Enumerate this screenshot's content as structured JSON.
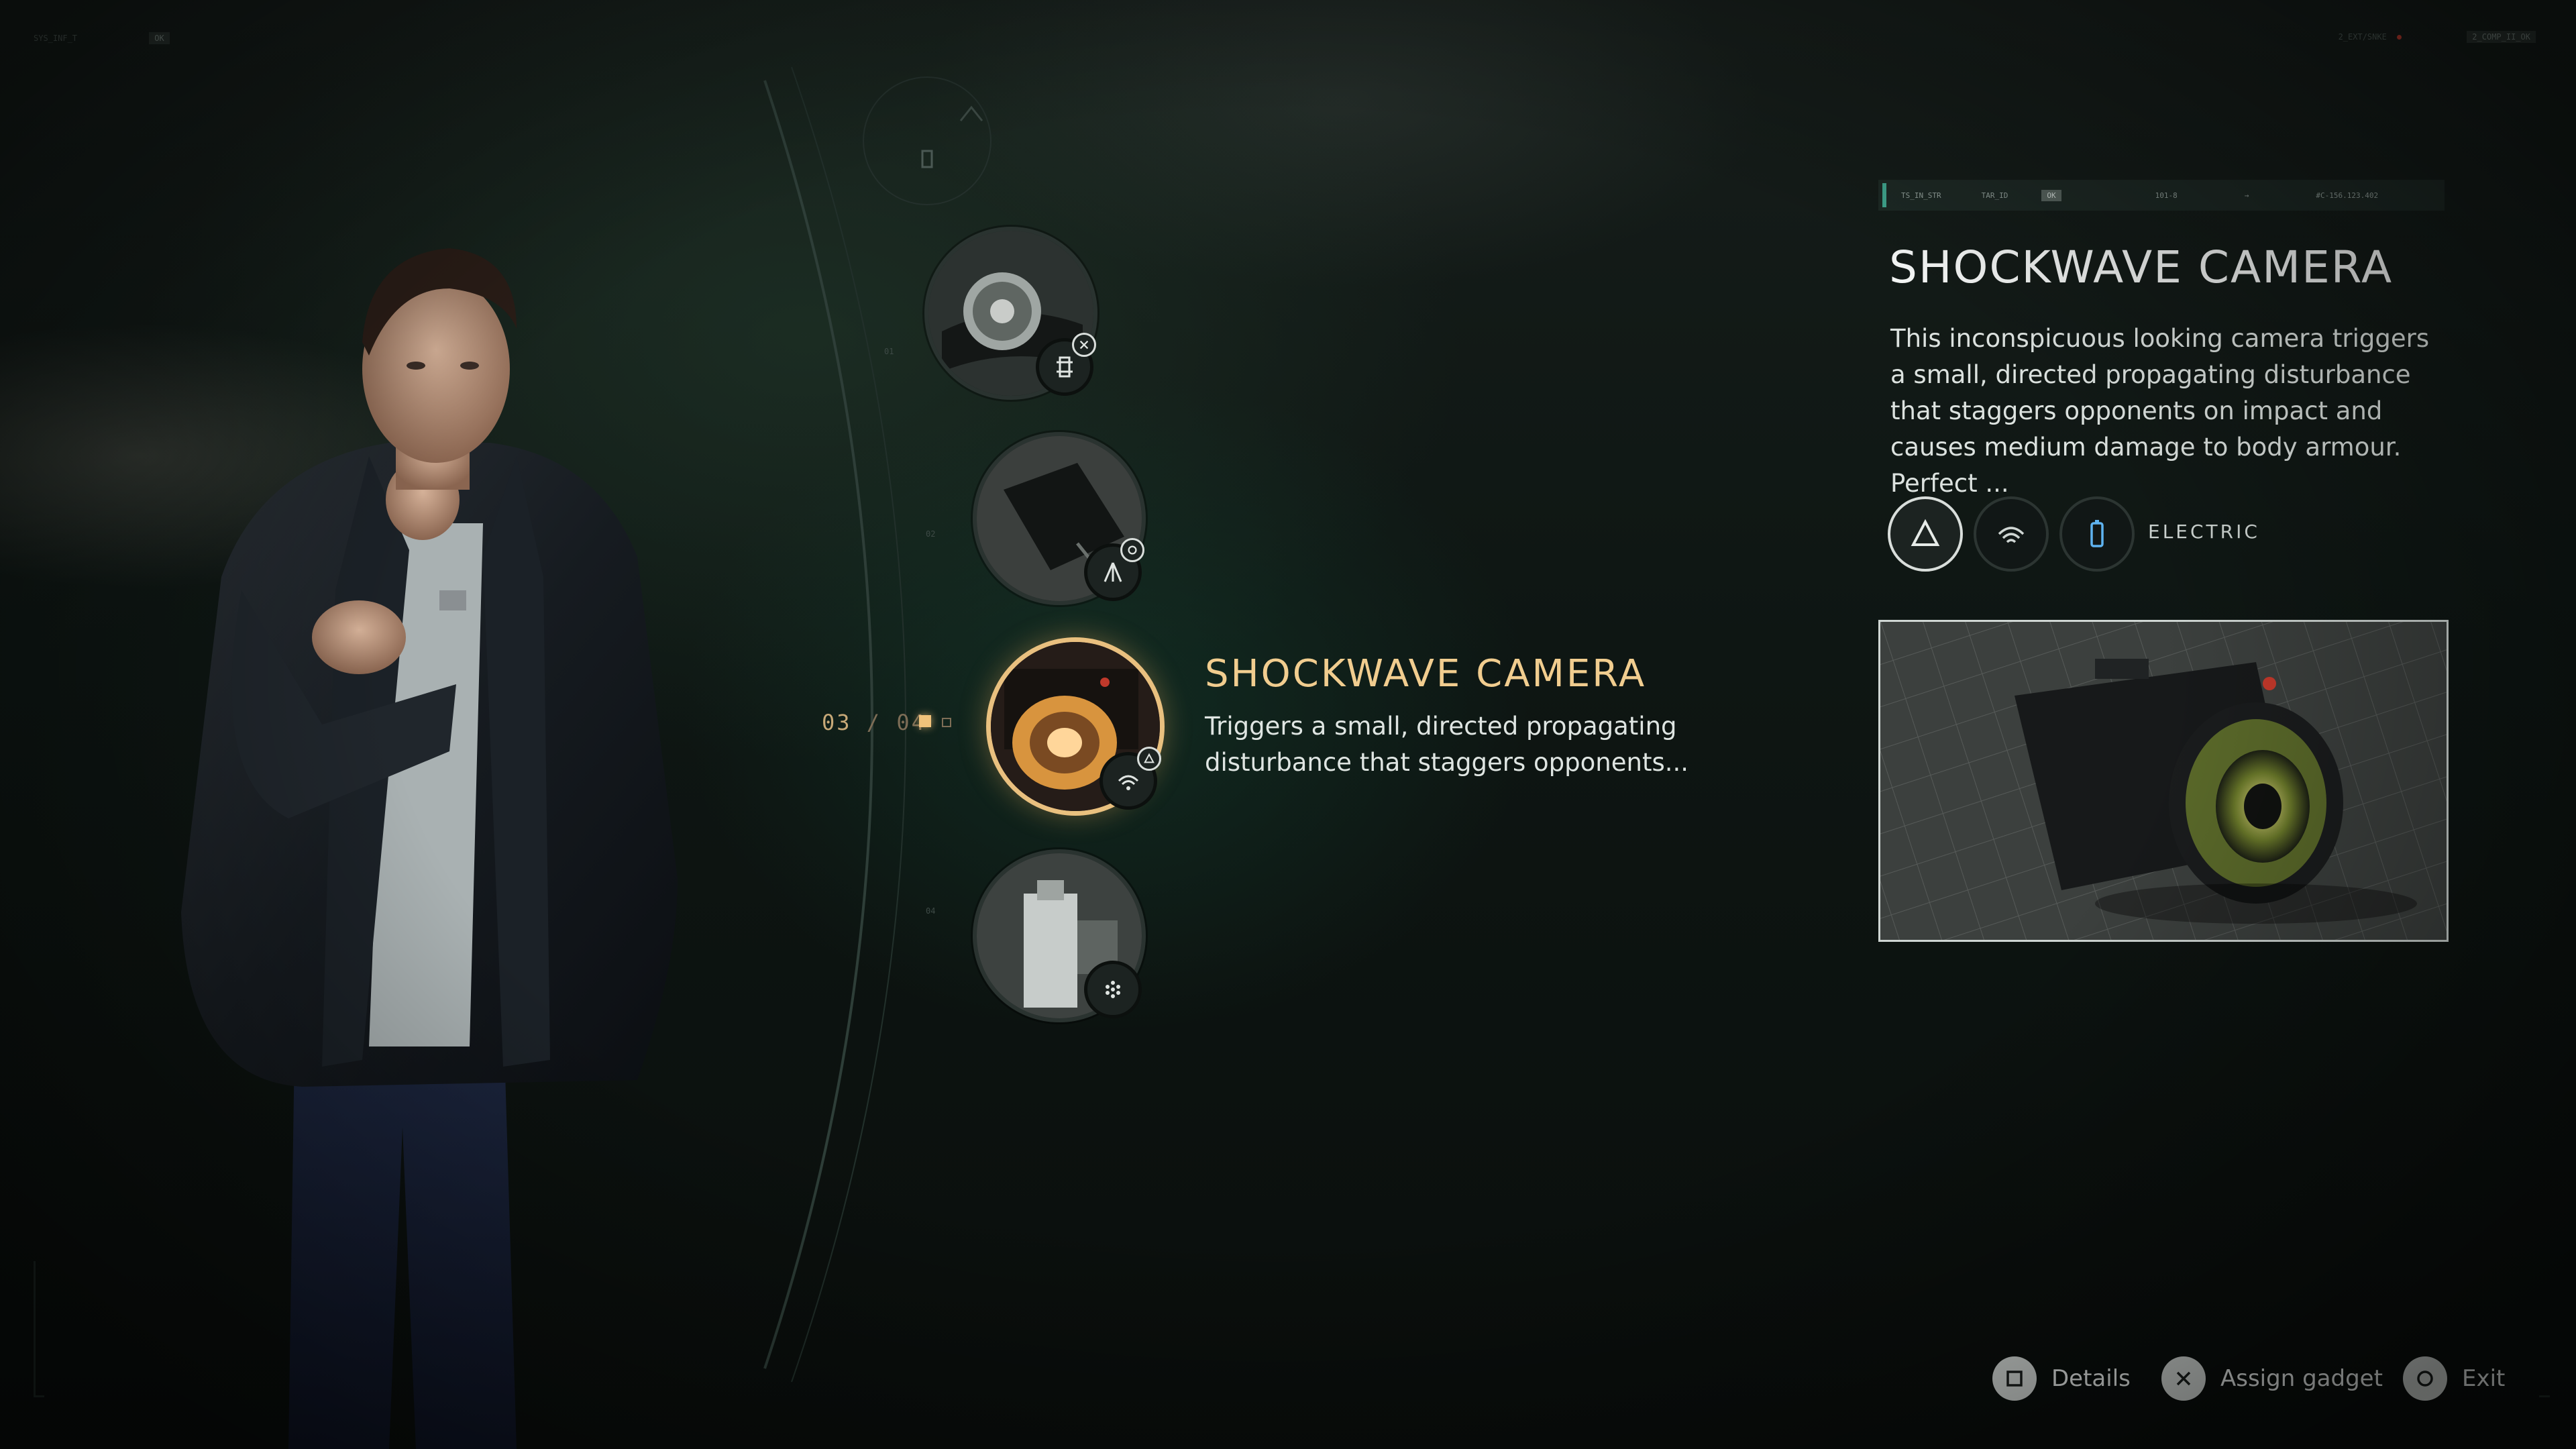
{
  "hud": {
    "top_left_code": "SYS_INF_T",
    "top_left_tag": "OK",
    "top_right_code": "2_EXT/SNKE",
    "top_right_tag": "2_COMP_II_OK"
  },
  "wheel": {
    "counter_current": "03",
    "counter_sep": "/",
    "counter_total": "04",
    "items": [
      {
        "name": "Wristwatch gadget",
        "badge_icon": "chip-icon",
        "button_icon": "cross-button-icon"
      },
      {
        "name": "Dark case gadget",
        "badge_icon": "tripod-icon",
        "button_icon": "circle-button-icon"
      },
      {
        "name": "Shockwave Camera",
        "badge_icon": "signal-icon",
        "button_icon": "triangle-button-icon",
        "selected": true
      },
      {
        "name": "Lighter gadget",
        "badge_icon": "dots-icon",
        "button_icon": ""
      }
    ]
  },
  "selected": {
    "title": "SHOCKWAVE CAMERA",
    "description": "Triggers a small, directed propagating disturbance that staggers opponents..."
  },
  "detail": {
    "header": {
      "f1": "TS_IN_STR",
      "f2": "TAR_ID",
      "f3": "OK",
      "f4": "101-8",
      "f5": "→",
      "f6": "#C-156.123.402"
    },
    "title": "SHOCKWAVE CAMERA",
    "description": "This inconspicuous looking camera triggers a small, directed propagating disturbance that staggers opponents on impact and causes medium damage to body armour. Perfect ...",
    "traits": [
      {
        "icon": "triangle-icon",
        "active": true
      },
      {
        "icon": "signal-icon",
        "active": false
      },
      {
        "icon": "battery-icon",
        "active": false
      }
    ],
    "trait_label": "ELECTRIC"
  },
  "prompts": {
    "details": "Details",
    "assign": "Assign gadget",
    "exit": "Exit"
  },
  "colors": {
    "accent_gold": "#e9c07f",
    "panel_teal": "#3fa38c",
    "text_light": "#e6ecea"
  }
}
